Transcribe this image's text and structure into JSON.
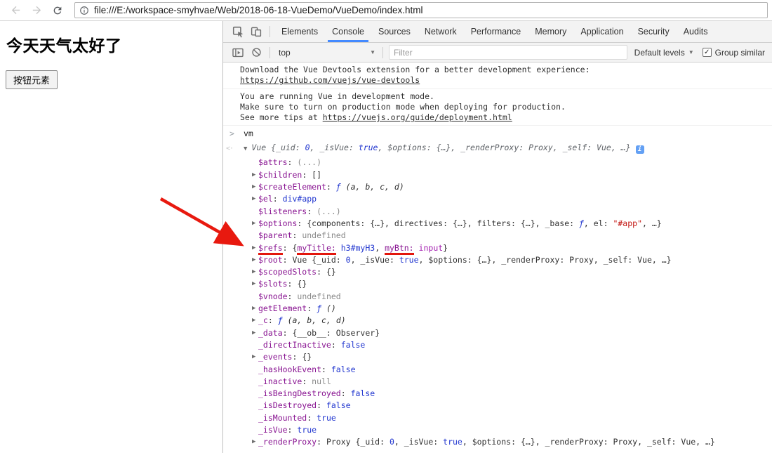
{
  "browser": {
    "url": "file:///E:/workspace-smyhvae/Web/2018-06-18-VueDemo/VueDemo/index.html"
  },
  "page": {
    "heading": "今天天气太好了",
    "button_label": "按钮元素"
  },
  "devtools": {
    "tabs": [
      "Elements",
      "Console",
      "Sources",
      "Network",
      "Performance",
      "Memory",
      "Application",
      "Security",
      "Audits"
    ],
    "active_tab": "Console",
    "toolbar": {
      "context_selector": "top",
      "filter_placeholder": "Filter",
      "levels_label": "Default levels",
      "group_similar_label": "Group similar",
      "group_similar_checked": true
    },
    "messages": [
      {
        "lines": [
          [
            {
              "t": "Download the Vue Devtools extension for a better development experience:"
            }
          ],
          [
            {
              "t": "https://github.com/vuejs/vue-devtools",
              "link": true
            }
          ]
        ]
      },
      {
        "lines": [
          [
            {
              "t": "You are running Vue in development mode."
            }
          ],
          [
            {
              "t": "Make sure to turn on production mode when deploying for production."
            }
          ],
          [
            {
              "t": "See more tips at "
            },
            {
              "t": "https://vuejs.org/guide/deployment.html",
              "link": true
            }
          ]
        ]
      }
    ],
    "command_echo": "vm",
    "result": {
      "segments": [
        {
          "t": "Vue {_uid: ",
          "c": "pv"
        },
        {
          "t": "0",
          "c": "num"
        },
        {
          "t": ", _isVue: ",
          "c": "pv"
        },
        {
          "t": "true",
          "c": "num"
        },
        {
          "t": ", $options: {…}, _renderProxy: Proxy, _self: Vue, …}",
          "c": "pv"
        }
      ]
    },
    "properties": [
      {
        "e": false,
        "s": [
          {
            "t": "$attrs",
            "c": "key"
          },
          {
            "t": ": ",
            "c": "txt"
          },
          {
            "t": "(...)",
            "c": "gray"
          }
        ]
      },
      {
        "e": true,
        "s": [
          {
            "t": "$children",
            "c": "key"
          },
          {
            "t": ": []",
            "c": "txt"
          }
        ]
      },
      {
        "e": true,
        "s": [
          {
            "t": "$createElement",
            "c": "key"
          },
          {
            "t": ": ",
            "c": "txt"
          },
          {
            "t": "ƒ",
            "c": "fn"
          },
          {
            "t": " (a, b, c, d)",
            "c": "it"
          }
        ]
      },
      {
        "e": true,
        "s": [
          {
            "t": "$el",
            "c": "key"
          },
          {
            "t": ": ",
            "c": "txt"
          },
          {
            "t": "div#app",
            "c": "node"
          }
        ]
      },
      {
        "e": false,
        "s": [
          {
            "t": "$listeners",
            "c": "key"
          },
          {
            "t": ": ",
            "c": "txt"
          },
          {
            "t": "(...)",
            "c": "gray"
          }
        ]
      },
      {
        "e": true,
        "s": [
          {
            "t": "$options",
            "c": "key"
          },
          {
            "t": ": {components: {…}, directives: {…}, filters: {…}, _base: ",
            "c": "txt"
          },
          {
            "t": "ƒ",
            "c": "fn"
          },
          {
            "t": ", el: ",
            "c": "txt"
          },
          {
            "t": "\"#app\"",
            "c": "str"
          },
          {
            "t": ", …}",
            "c": "txt"
          }
        ]
      },
      {
        "e": false,
        "s": [
          {
            "t": "$parent",
            "c": "key"
          },
          {
            "t": ": ",
            "c": "txt"
          },
          {
            "t": "undefined",
            "c": "gray"
          }
        ]
      },
      {
        "e": true,
        "s": [
          {
            "t": "$refs",
            "c": "key",
            "u": true
          },
          {
            "t": ": {",
            "c": "txt"
          },
          {
            "t": "myTitle:",
            "c": "key",
            "u": true
          },
          {
            "t": " ",
            "c": "txt"
          },
          {
            "t": "h3#myH3",
            "c": "node"
          },
          {
            "t": ", ",
            "c": "txt"
          },
          {
            "t": "myBtn:",
            "c": "key",
            "u": true
          },
          {
            "t": " ",
            "c": "txt"
          },
          {
            "t": "input",
            "c": "nodem"
          },
          {
            "t": "}",
            "c": "txt"
          }
        ]
      },
      {
        "e": true,
        "s": [
          {
            "t": "$root",
            "c": "key"
          },
          {
            "t": ": Vue {_uid: ",
            "c": "txt"
          },
          {
            "t": "0",
            "c": "num"
          },
          {
            "t": ", _isVue: ",
            "c": "txt"
          },
          {
            "t": "true",
            "c": "num"
          },
          {
            "t": ", $options: {…}, _renderProxy: Proxy, _self: Vue, …}",
            "c": "txt"
          }
        ]
      },
      {
        "e": true,
        "s": [
          {
            "t": "$scopedSlots",
            "c": "key"
          },
          {
            "t": ": {}",
            "c": "txt"
          }
        ]
      },
      {
        "e": true,
        "s": [
          {
            "t": "$slots",
            "c": "key"
          },
          {
            "t": ": {}",
            "c": "txt"
          }
        ]
      },
      {
        "e": false,
        "s": [
          {
            "t": "$vnode",
            "c": "key"
          },
          {
            "t": ": ",
            "c": "txt"
          },
          {
            "t": "undefined",
            "c": "gray"
          }
        ]
      },
      {
        "e": true,
        "s": [
          {
            "t": "getElement",
            "c": "key"
          },
          {
            "t": ": ",
            "c": "txt"
          },
          {
            "t": "ƒ",
            "c": "fn"
          },
          {
            "t": " ()",
            "c": "it"
          }
        ]
      },
      {
        "e": true,
        "s": [
          {
            "t": "_c",
            "c": "key"
          },
          {
            "t": ": ",
            "c": "txt"
          },
          {
            "t": "ƒ",
            "c": "fn"
          },
          {
            "t": " (a, b, c, d)",
            "c": "it"
          }
        ]
      },
      {
        "e": true,
        "s": [
          {
            "t": "_data",
            "c": "key"
          },
          {
            "t": ": {__ob__: Observer}",
            "c": "txt"
          }
        ]
      },
      {
        "e": false,
        "s": [
          {
            "t": "_directInactive",
            "c": "key"
          },
          {
            "t": ": ",
            "c": "txt"
          },
          {
            "t": "false",
            "c": "num"
          }
        ]
      },
      {
        "e": true,
        "s": [
          {
            "t": "_events",
            "c": "key"
          },
          {
            "t": ": {}",
            "c": "txt"
          }
        ]
      },
      {
        "e": false,
        "s": [
          {
            "t": "_hasHookEvent",
            "c": "key"
          },
          {
            "t": ": ",
            "c": "txt"
          },
          {
            "t": "false",
            "c": "num"
          }
        ]
      },
      {
        "e": false,
        "s": [
          {
            "t": "_inactive",
            "c": "key"
          },
          {
            "t": ": ",
            "c": "txt"
          },
          {
            "t": "null",
            "c": "gray"
          }
        ]
      },
      {
        "e": false,
        "s": [
          {
            "t": "_isBeingDestroyed",
            "c": "key"
          },
          {
            "t": ": ",
            "c": "txt"
          },
          {
            "t": "false",
            "c": "num"
          }
        ]
      },
      {
        "e": false,
        "s": [
          {
            "t": "_isDestroyed",
            "c": "key"
          },
          {
            "t": ": ",
            "c": "txt"
          },
          {
            "t": "false",
            "c": "num"
          }
        ]
      },
      {
        "e": false,
        "s": [
          {
            "t": "_isMounted",
            "c": "key"
          },
          {
            "t": ": ",
            "c": "txt"
          },
          {
            "t": "true",
            "c": "num"
          }
        ]
      },
      {
        "e": false,
        "s": [
          {
            "t": "_isVue",
            "c": "key"
          },
          {
            "t": ": ",
            "c": "txt"
          },
          {
            "t": "true",
            "c": "num"
          }
        ]
      },
      {
        "e": true,
        "s": [
          {
            "t": "_renderProxy",
            "c": "key"
          },
          {
            "t": ": Proxy {_uid: ",
            "c": "txt"
          },
          {
            "t": "0",
            "c": "num"
          },
          {
            "t": ", _isVue: ",
            "c": "txt"
          },
          {
            "t": "true",
            "c": "num"
          },
          {
            "t": ", $options: {…}, _renderProxy: Proxy, _self: Vue, …}",
            "c": "txt"
          }
        ]
      }
    ]
  },
  "colors": {
    "active_tab_accent": "#448aff",
    "key_purple": "#881391",
    "value_blue": "#2136cf",
    "string_red": "#c41a16",
    "annotation_red": "#e8190f"
  }
}
